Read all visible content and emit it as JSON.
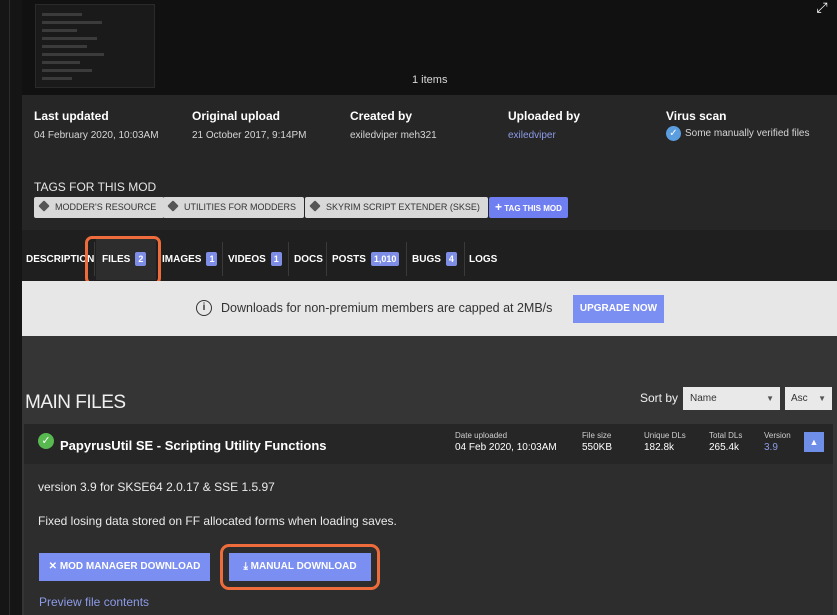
{
  "gallery": {
    "items_count": "1 items"
  },
  "meta": {
    "last_updated": {
      "label": "Last updated",
      "value": "04 February 2020,  10:03AM"
    },
    "original_upload": {
      "label": "Original upload",
      "value": "21 October 2017,  9:14PM"
    },
    "created_by": {
      "label": "Created by",
      "value": "exiledviper meh321"
    },
    "uploaded_by": {
      "label": "Uploaded by",
      "value": "exiledviper"
    },
    "virus_scan": {
      "label": "Virus scan",
      "value": "Some manually verified files"
    }
  },
  "tags": {
    "title": "TAGS FOR THIS MOD",
    "items": [
      "MODDER'S RESOURCE",
      "UTILITIES FOR MODDERS",
      "SKYRIM SCRIPT EXTENDER (SKSE)"
    ],
    "add_label": "TAG THIS MOD"
  },
  "tabs": [
    {
      "label": "DESCRIPTION",
      "badge": ""
    },
    {
      "label": "FILES",
      "badge": "2"
    },
    {
      "label": "IMAGES",
      "badge": "1"
    },
    {
      "label": "VIDEOS",
      "badge": "1"
    },
    {
      "label": "DOCS",
      "badge": ""
    },
    {
      "label": "POSTS",
      "badge": "1,010"
    },
    {
      "label": "BUGS",
      "badge": "4"
    },
    {
      "label": "LOGS",
      "badge": ""
    }
  ],
  "notice": {
    "text": "Downloads for non-premium members are capped at 2MB/s",
    "upgrade_label": "UPGRADE NOW"
  },
  "files": {
    "section_title": "MAIN FILES",
    "sort_label": "Sort by",
    "sort_field": "Name",
    "sort_order": "Asc",
    "file": {
      "title": "PapyrusUtil SE - Scripting Utility Functions",
      "date_uploaded_label": "Date uploaded",
      "date_uploaded": "04 Feb 2020, 10:03AM",
      "file_size_label": "File size",
      "file_size": "550KB",
      "unique_dls_label": "Unique DLs",
      "unique_dls": "182.8k",
      "total_dls_label": "Total DLs",
      "total_dls": "265.4k",
      "version_label": "Version",
      "version": "3.9",
      "version_text": "version 3.9 for SKSE64 2.0.17 & SSE 1.5.97",
      "description": "Fixed losing data stored on FF allocated forms when loading saves.",
      "mod_manager_label": "MOD MANAGER DOWNLOAD",
      "manual_label": "MANUAL DOWNLOAD",
      "preview_label": "Preview file contents"
    }
  },
  "colors": {
    "accent": "#7b8ef2",
    "highlight": "#ee6c3b",
    "success": "#57b94f"
  }
}
